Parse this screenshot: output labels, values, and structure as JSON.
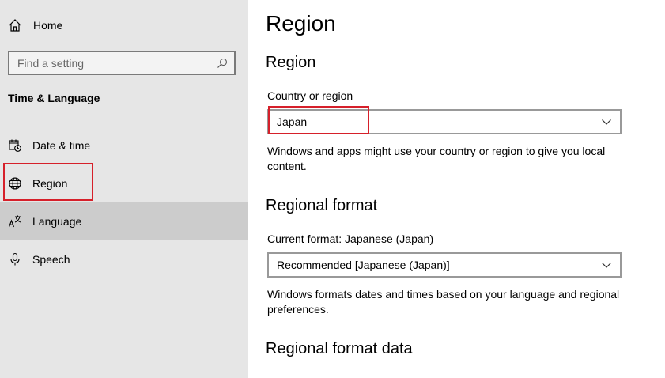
{
  "sidebar": {
    "home_label": "Home",
    "search": {
      "placeholder": "Find a setting"
    },
    "section_title": "Time & Language",
    "items": [
      {
        "label": "Date & time",
        "icon": "calendar-clock-icon"
      },
      {
        "label": "Region",
        "icon": "globe-icon",
        "highlighted": true
      },
      {
        "label": "Language",
        "icon": "language-icon",
        "selected": true
      },
      {
        "label": "Speech",
        "icon": "microphone-icon"
      }
    ]
  },
  "main": {
    "page_title": "Region",
    "region_section": {
      "title": "Region",
      "country_label": "Country or region",
      "country_value": "Japan",
      "description": "Windows and apps might use your country or region to give you local content."
    },
    "format_section": {
      "title": "Regional format",
      "current_label": "Current format: Japanese (Japan)",
      "format_value": "Recommended [Japanese (Japan)]",
      "description": "Windows formats dates and times based on your language and regional preferences."
    },
    "format_data_section": {
      "title": "Regional format data"
    }
  },
  "colors": {
    "sidebar_bg": "#e6e6e6",
    "selected_bg": "#cccccc",
    "highlight": "#d6202a"
  }
}
